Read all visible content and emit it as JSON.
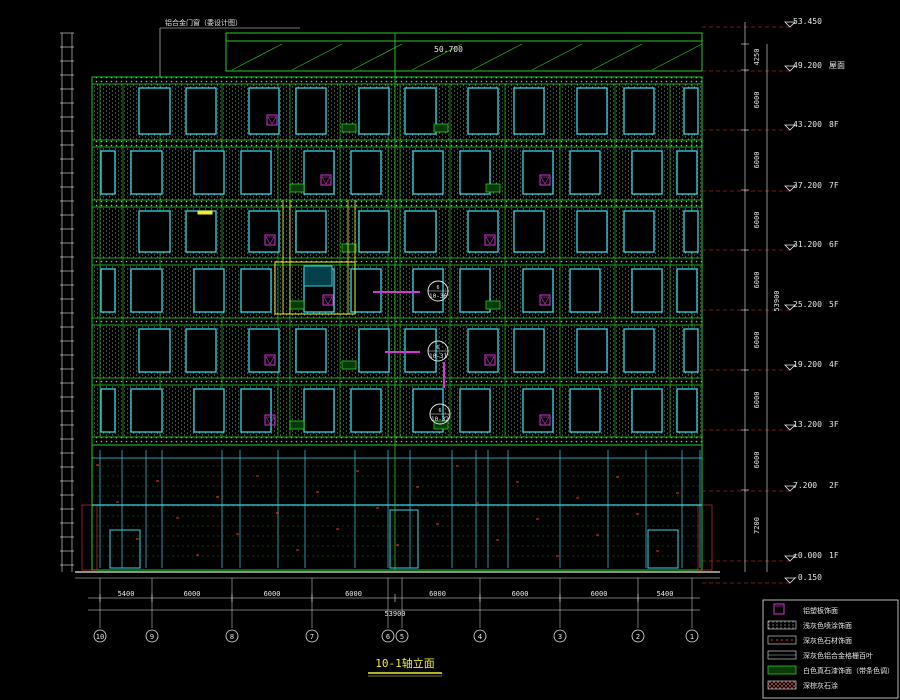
{
  "colors": {
    "background": "#000000",
    "green": "#22cc22",
    "cyan": "#33d6e6",
    "yellow": "#eeee33",
    "white": "#e8e8e8",
    "magenta": "#d633d6",
    "red": "#ee3333"
  },
  "drawing": {
    "title": "10-1轴立面",
    "top_note": "铝合金门窗（委设计图）",
    "parapet_value": "50.700",
    "total_height_dim": "53900",
    "total_width_dim": "53900"
  },
  "elevations": [
    {
      "value": "53.450",
      "label": ""
    },
    {
      "value": "49.200",
      "label": "屋面"
    },
    {
      "value": "43.200",
      "label": "8F"
    },
    {
      "value": "37.200",
      "label": "7F"
    },
    {
      "value": "31.200",
      "label": "6F"
    },
    {
      "value": "25.200",
      "label": "5F"
    },
    {
      "value": "19.200",
      "label": "4F"
    },
    {
      "value": "13.200",
      "label": "3F"
    },
    {
      "value": "7.200",
      "label": "2F"
    },
    {
      "value": "±0.000",
      "label": "1F"
    },
    {
      "value": "-0.150",
      "label": ""
    }
  ],
  "right_dims": [
    "4250",
    "6000",
    "6000",
    "6000",
    "6000",
    "6000",
    "6000",
    "6000",
    "7200"
  ],
  "bottom_dims": [
    "5400",
    "6000",
    "6000",
    "6000",
    "6000",
    "6000",
    "6000",
    "5400"
  ],
  "axes": [
    "10",
    "9",
    "8",
    "7",
    "6",
    "5",
    "4",
    "3",
    "2",
    "1"
  ],
  "callouts": [
    "10-36",
    "10-31",
    "10-32"
  ],
  "legend": [
    {
      "swatch": "marker",
      "text": "铝塑板饰面"
    },
    {
      "swatch": "dots",
      "text": "浅灰色喷涂饰面"
    },
    {
      "swatch": "dash",
      "text": "深灰色石材饰面"
    },
    {
      "swatch": "grid",
      "text": "深灰色铝合金格栅百叶"
    },
    {
      "swatch": "green",
      "text": "白色真石漆饰面（带条色调）"
    },
    {
      "swatch": "cross",
      "text": "深棕灰石涂"
    }
  ]
}
